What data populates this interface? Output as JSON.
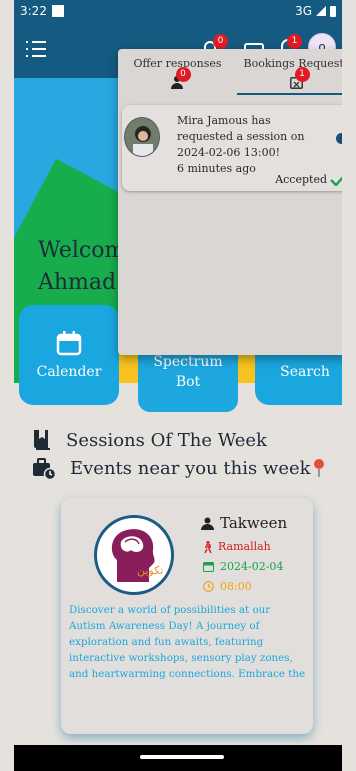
{
  "status_bar": {
    "time": "3:22",
    "network": "3G"
  },
  "app_bar": {
    "notification_badge": "0",
    "messages_badge": "1",
    "avatar_initial": "o"
  },
  "hero": {
    "welcome_line1": "Welcom",
    "welcome_line2": "Ahmad"
  },
  "quick_actions": [
    {
      "label": "Calender"
    },
    {
      "label_line1": "Spectrum",
      "label_line2": "Bot"
    },
    {
      "label": "Search"
    }
  ],
  "sections": {
    "sessions_title": "Sessions Of The Week",
    "events_title": "Events near you this week"
  },
  "event_card": {
    "name": "Takween",
    "location": "Ramallah",
    "date": "2024-02-04",
    "time": "08:00",
    "logo_text": "تكوين",
    "description": "Discover a world of possibilities at our Autism Awareness Day! A journey of exploration and fun awaits, featuring interactive workshops, sensory play zones, and heartwarming connections. Embrace the uniqueness of ever…"
  },
  "notifications_popup": {
    "tabs": [
      {
        "label": "Offer responses",
        "badge": "0"
      },
      {
        "label": "Bookings Requests",
        "badge": "1"
      }
    ],
    "active_tab": "Bookings Requests",
    "items": [
      {
        "message": "Mira Jamous has requested a session on 2024-02-06 13:00!",
        "time_ago": "6 minutes ago",
        "status": "Accepted"
      }
    ]
  },
  "colors": {
    "primary": "#155a80",
    "accent_blue": "#1aa7df",
    "badge_red": "#e01b24",
    "location_red": "#d31f1f",
    "date_green": "#1aa34a",
    "time_orange": "#f3a10d"
  }
}
